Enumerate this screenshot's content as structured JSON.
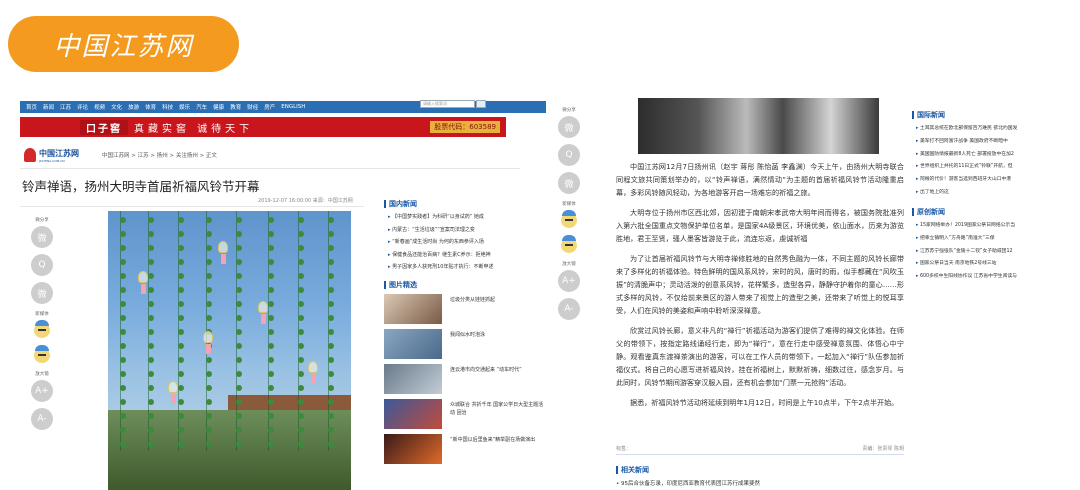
{
  "badge": {
    "label": "中国江苏网"
  },
  "left": {
    "nav": [
      "首页",
      "新闻",
      "江苏",
      "评论",
      "视频",
      "文化",
      "旅游",
      "体育",
      "科技",
      "娱乐",
      "汽车",
      "健康",
      "教育",
      "财经",
      "房产",
      "ENGLISH"
    ],
    "search_placeholder": "请输入搜索词",
    "banner": {
      "brand": "口子窖",
      "slogan": "真藏实窖  诚待天下",
      "stock": "股票代码：603589"
    },
    "logo": {
      "name": "中国江苏网",
      "domain": "JSCHINA.COM.CN"
    },
    "breadcrumb": "中国江苏网 > 江苏 > 扬州 > 关注扬州 > 正文",
    "title": "铃声禅语，扬州大明寺首届祈福风铃节开幕",
    "meta": "2019-12-07 16:00:00  来源：中国江苏网",
    "share": {
      "label": "微分享",
      "circles": [
        "微",
        "Q",
        "微"
      ],
      "fav_label": "新媒体",
      "font_label": "放大镜",
      "font_buttons": [
        "A+",
        "A-"
      ]
    },
    "domestic": {
      "heading": "国内新闻",
      "items": [
        "【中国梦实践者】为科研“以身试药”  她成",
        "内蒙古：“生活垃圾”“宣案司法理之变",
        "“新春画”成生活时尚 为何的东西参评入场",
        "保健食品还能治百病？继生素C养示：拒绝神",
        "男子因家多人获死刑10年贴才执行：不断申述"
      ]
    },
    "pictures": {
      "heading": "图片精选",
      "items": [
        "垃圾分类从娃娃抓起",
        "我闻似水时泡泳",
        "连云港市向交通起来 “动车时代”",
        "众城联合 共折千年 国家公学日大型主题活动 固治",
        "“新中国以后里鱼来”精举副在场做演出"
      ]
    }
  },
  "right": {
    "share": {
      "label": "微分享",
      "circles": [
        "微",
        "Q",
        "微"
      ],
      "fav_label": "新媒体",
      "font_label": "放大镜",
      "font_buttons": [
        "A+",
        "A-"
      ]
    },
    "paragraphs": [
      "中国江苏网12月7日扬州讯（赵宇 蒋彤 陈怡菡 李鑫渊）今天上午，由扬州大明寺联合同程文旅共同策划举办的，以“铃声禅语，满然情动”为主题的首届祈福风铃节活动隆重启幕，多彩风铃随风轻动，为各地游客开启一场难忘的祈福之旅。",
      "大明寺位于扬州市区西北郊，因初建于南朝宋孝武帝大明年间而得名，被国务院批准列入第六批全国重点文物保护单位名单，是国家4A级景区，环境优美，依山面水，历来为游览胜地，君王至贤，骚人墨客皆游览于此，流连忘返，虔诚祈福",
      "为了让首届祈福风铃节与大明寺禅修胜地的自然秀色融为一体，不同主题的风铃长廊带来了多样化的祈福体验。特色鲜明的国风系风铃，宋时的风，唐时的雨，似手都藏在“风吹玉振”的清脆声中；灵动活泼的创意系风铃，花样繁多，造型各异，静静守护着你的童心……形式多样的风铃，不仅给前来景区的游人带来了视觉上的造型之美，还带来了听觉上的悦耳享受，人们在风铃的美姿和声响中聆听深深禅意。",
      "欣赏过风铃长廊，意义非凡的“禅行”祈福活动为游客们提供了难得的禅文化体验。在师父的带领下，按指定路线诵经行走，即为“禅行”，意在行走中感受禅意氛围、体悟心中宁静。观看鉴真东渡禅茶演出的游客，可以在工作人员的带领下，一起加入“禅行”队伍参加祈福仪式。将自己的心愿写进祈福风铃，挂在祈福树上，默默祈祷，细数过往，感念岁月。与此同时，风铃节期间游客穿汉服入园，还有机会参加“门票一元抢购”活动。",
      "据悉，祈福风铃节活动将延续到明年1月12日，时间是上午10点半，下午2点半开始。"
    ],
    "footer": {
      "tags": "标签：",
      "editor": "责编：张贵琴  陈玥"
    },
    "related": {
      "heading": "相关新闻",
      "item": "• 95后合伙备忘录，印度尼西亚教育代表团江苏行成果斐然"
    },
    "intl": {
      "heading": "国际新闻",
      "items": [
        "土耳其总统在欧北部保留百万难民 欲北约国发",
        "美军打不回阿富汗战争 美国政府不断暗中",
        "美国国防情报最新8人死亡 部署投放中在加2",
        "世界组织上并托的11日正式“铃联”开航，但",
        "阿根的代价！游客当选到西班牙大山口中港",
        "出了地上的这"
      ]
    },
    "original": {
      "heading": "原创新闻",
      "items": [
        "15家网络举办！2019国家公祭日网络公示当",
        "把幸立镇明入“方舟路”南淮大“三保",
        "江苏苏宁强强队“金陵十二钗”女子助威团12",
        "国家公祭日当天 南京地铁2号线三站",
        "600多校中生阳线协作议 江苏省中学生阅读与"
      ]
    }
  }
}
